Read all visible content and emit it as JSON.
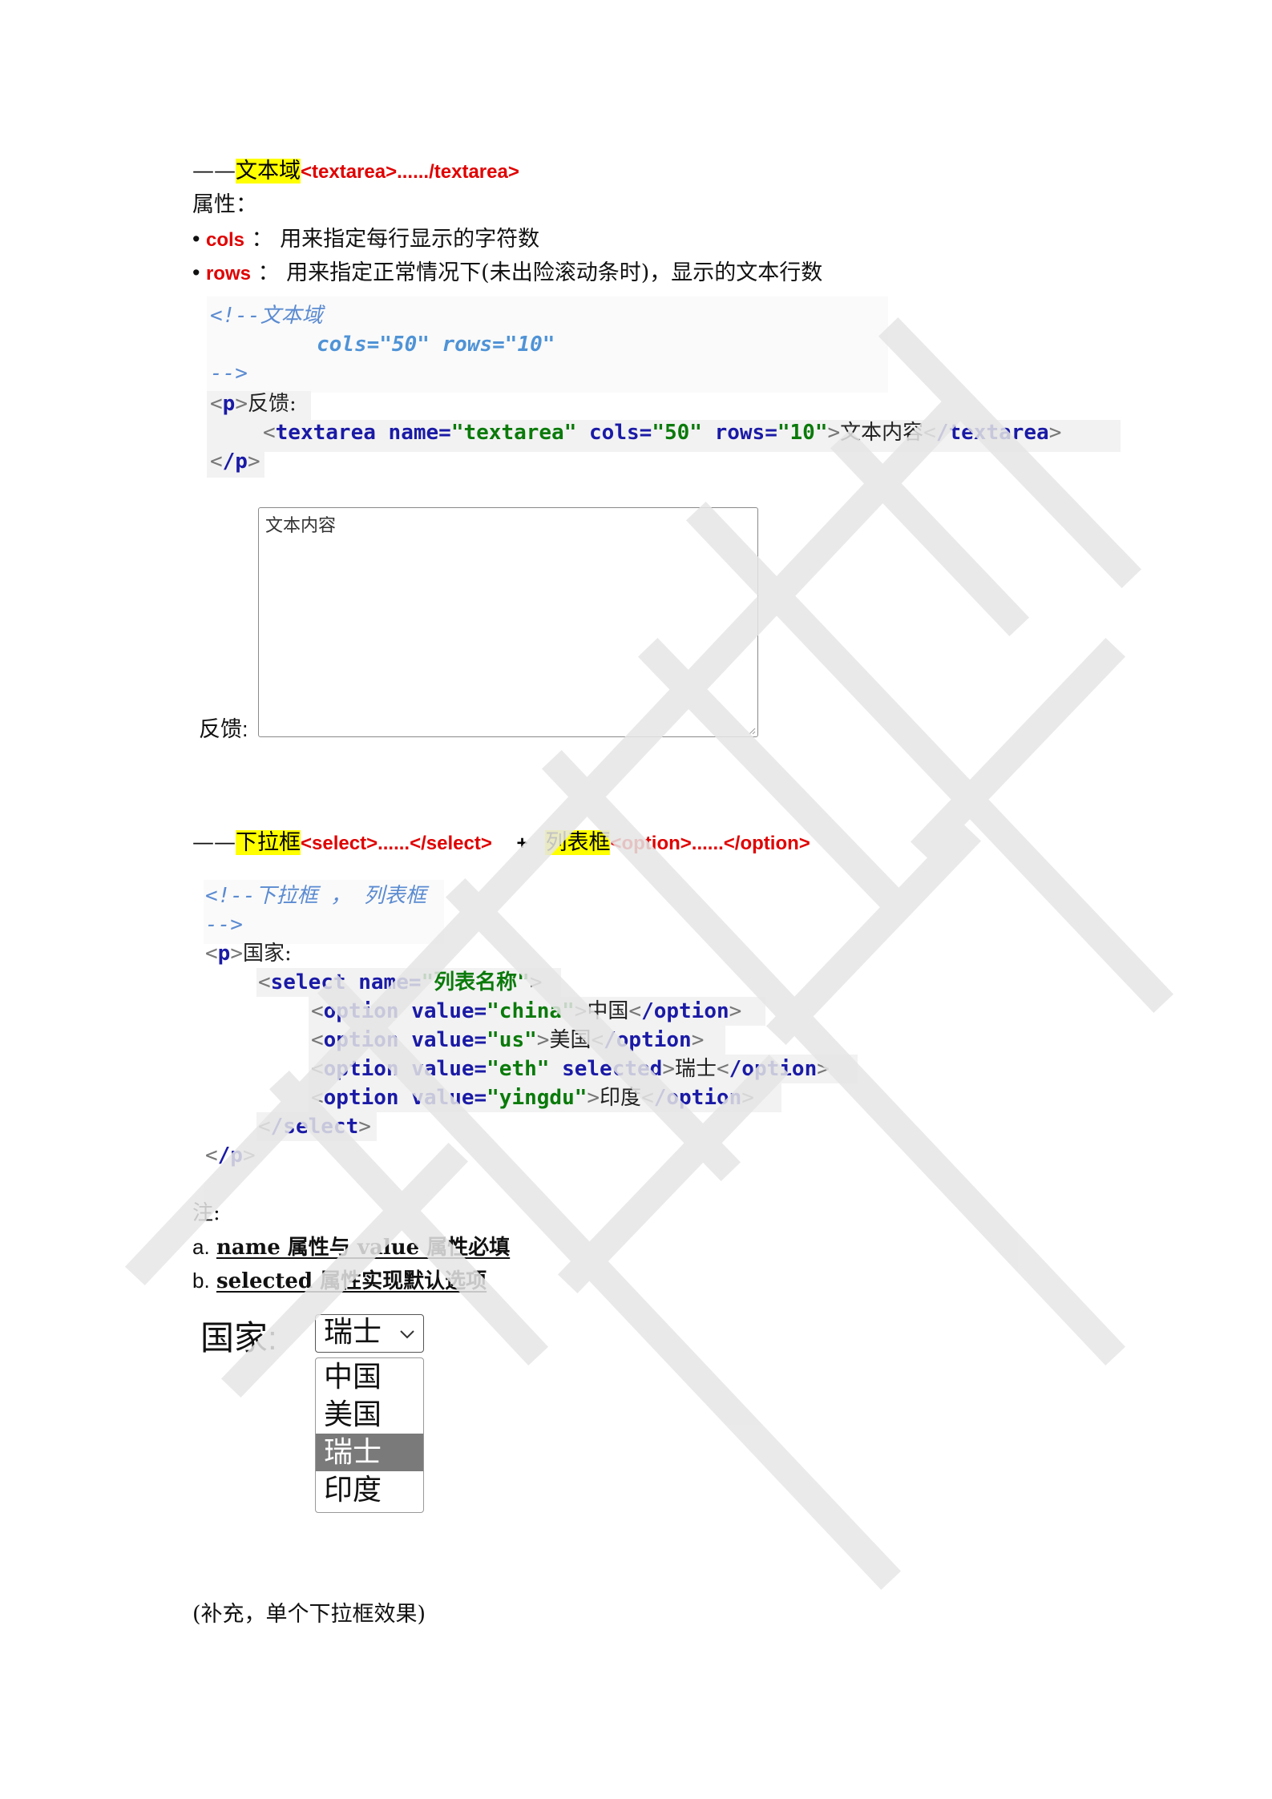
{
  "textarea_section": {
    "dash": "——",
    "title_hl": "文本域",
    "title_tag": "<textarea>....../textarea>",
    "attr_label": "属性：",
    "bullets": [
      {
        "name": "cols",
        "sep": "：",
        "desc": "用来指定每行显示的字符数"
      },
      {
        "name": "rows",
        "sep": "：",
        "desc": "用来指定正常情况下(未出险滚动条时)，显示的文本行数"
      }
    ],
    "code": {
      "comment_open": "<!--文本域",
      "comment_attrs": "cols=\"50\" rows=\"10\"",
      "comment_close": "-->",
      "p_open_tag": "p",
      "p_text": "反馈:",
      "ta_tag": "textarea",
      "ta_name_attr": "name=",
      "ta_name_val": "\"textarea\"",
      "ta_cols_attr": "cols=",
      "ta_cols_val": "\"50\"",
      "ta_rows_attr": "rows=",
      "ta_rows_val": "\"10\"",
      "ta_text": "文本内容",
      "ta_close_tag": "/textarea",
      "p_close_tag": "/p"
    },
    "preview": {
      "label": "反馈:",
      "content": "文本内容"
    }
  },
  "select_section": {
    "dash": "——",
    "title_hl": "下拉框",
    "title_tag": "<select>......</select>",
    "plus": "+",
    "title2_hl": "列表框",
    "title2_tag": "<option>......</option>",
    "code": {
      "comment_open": "<!--下拉框 ， 列表框",
      "comment_close": "-->",
      "p_open_tag": "p",
      "p_text": "国家:",
      "select_tag": "select",
      "select_name_attr": "name=",
      "select_name_val": "\"列表名称\"",
      "options": [
        {
          "tag": "option",
          "value_attr": "value=",
          "value": "\"china\"",
          "selected": "",
          "text": "中国",
          "close": "/option"
        },
        {
          "tag": "option",
          "value_attr": "value=",
          "value": "\"us\"",
          "selected": "",
          "text": "美国",
          "close": "/option"
        },
        {
          "tag": "option",
          "value_attr": "value=",
          "value": "\"eth\"",
          "selected": "selected",
          "text": "瑞士",
          "close": "/option"
        },
        {
          "tag": "option",
          "value_attr": "value=",
          "value": "\"yingdu\"",
          "selected": "",
          "text": "印度",
          "close": "/option"
        }
      ],
      "select_close_tag": "/select",
      "p_close_tag": "/p"
    },
    "notes": {
      "label": "注:",
      "a_prefix": "a.",
      "a_text": "name 属性与 value 属性必填",
      "b_prefix": "b.",
      "b_text": "selected 属性实现默认选项"
    },
    "preview": {
      "label": "国家:",
      "selected_value": "瑞士",
      "chevron": "chevron-down-icon",
      "options": [
        "中国",
        "美国",
        "瑞士",
        "印度"
      ],
      "active_index": 2
    },
    "supplement": "(补充，单个下拉框效果)"
  }
}
